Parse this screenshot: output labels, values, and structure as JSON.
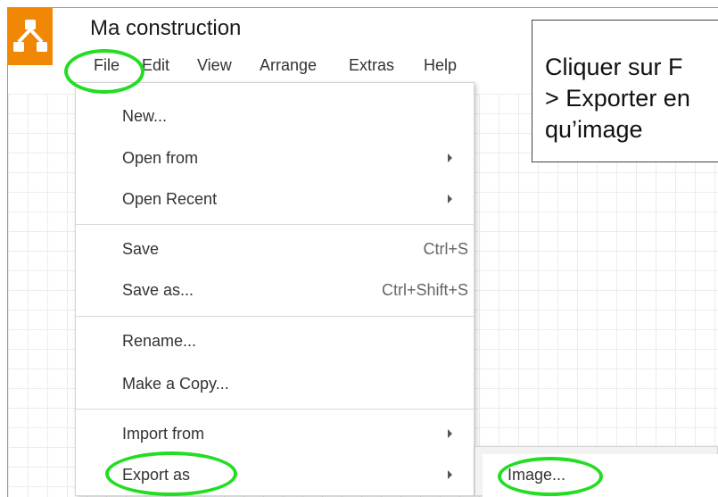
{
  "app": {
    "title": "Ma construction",
    "logo_icon": "drawio-logo-icon",
    "logo_color": "#f08705"
  },
  "menubar": [
    "File",
    "Edit",
    "View",
    "Arrange",
    "Extras",
    "Help"
  ],
  "file_menu": {
    "items": [
      {
        "label": "New...",
        "shortcut": "",
        "submenu": false
      },
      {
        "label": "Open from",
        "shortcut": "",
        "submenu": true
      },
      {
        "label": "Open Recent",
        "shortcut": "",
        "submenu": true
      },
      {
        "label": "Save",
        "shortcut": "Ctrl+S",
        "submenu": false
      },
      {
        "label": "Save as...",
        "shortcut": "Ctrl+Shift+S",
        "submenu": false
      },
      {
        "label": "Rename...",
        "shortcut": "",
        "submenu": false
      },
      {
        "label": "Make a Copy...",
        "shortcut": "",
        "submenu": false
      },
      {
        "label": "Import from",
        "shortcut": "",
        "submenu": true
      },
      {
        "label": "Export as",
        "shortcut": "",
        "submenu": true
      }
    ]
  },
  "export_submenu": {
    "items": [
      {
        "label": "Image..."
      }
    ]
  },
  "callout": {
    "text": "Cliquer sur F\n> Exporter en\nqu’image"
  },
  "highlight_color": "#22dd22"
}
